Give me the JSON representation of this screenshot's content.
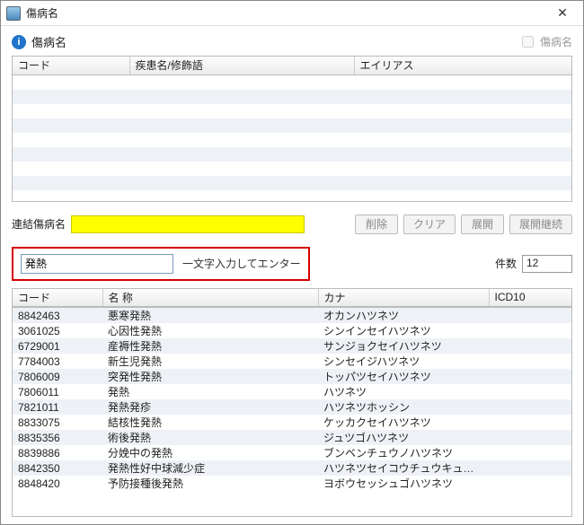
{
  "window": {
    "title": "傷病名"
  },
  "header": {
    "title": "傷病名",
    "checkbox_label": "傷病名"
  },
  "upper_table": {
    "columns": [
      "コード",
      "疾患名/修飾語",
      "エイリアス"
    ]
  },
  "linked": {
    "label": "連結傷病名"
  },
  "buttons": {
    "delete": "削除",
    "clear": "クリア",
    "expand": "展開",
    "expand_cont": "展開継続"
  },
  "search": {
    "value": "発熱",
    "hint": "一文字入力してエンター",
    "count_label": "件数",
    "count_value": "12"
  },
  "lower_table": {
    "columns": [
      "コード",
      "名 称",
      "カナ",
      "ICD10"
    ],
    "rows": [
      {
        "code": "8842463",
        "name": "悪寒発熱",
        "kana": "オカンハツネツ",
        "icd": ""
      },
      {
        "code": "3061025",
        "name": "心因性発熱",
        "kana": "シンインセイハツネツ",
        "icd": ""
      },
      {
        "code": "6729001",
        "name": "産褥性発熱",
        "kana": "サンジョクセイハツネツ",
        "icd": ""
      },
      {
        "code": "7784003",
        "name": "新生児発熱",
        "kana": "シンセイジハツネツ",
        "icd": ""
      },
      {
        "code": "7806009",
        "name": "突発性発熱",
        "kana": "トッパツセイハツネツ",
        "icd": ""
      },
      {
        "code": "7806011",
        "name": "発熱",
        "kana": "ハツネツ",
        "icd": ""
      },
      {
        "code": "7821011",
        "name": "発熱発疹",
        "kana": "ハツネツホッシン",
        "icd": ""
      },
      {
        "code": "8833075",
        "name": "結核性発熱",
        "kana": "ケッカクセイハツネツ",
        "icd": ""
      },
      {
        "code": "8835356",
        "name": "術後発熱",
        "kana": "ジュツゴハツネツ",
        "icd": ""
      },
      {
        "code": "8839886",
        "name": "分娩中の発熱",
        "kana": "ブンベンチュウノハツネツ",
        "icd": ""
      },
      {
        "code": "8842350",
        "name": "発熱性好中球減少症",
        "kana": "ハツネツセイコウチュウキュウゲ…",
        "icd": ""
      },
      {
        "code": "8848420",
        "name": "予防接種後発熱",
        "kana": "ヨボウセッシュゴハツネツ",
        "icd": ""
      }
    ]
  }
}
